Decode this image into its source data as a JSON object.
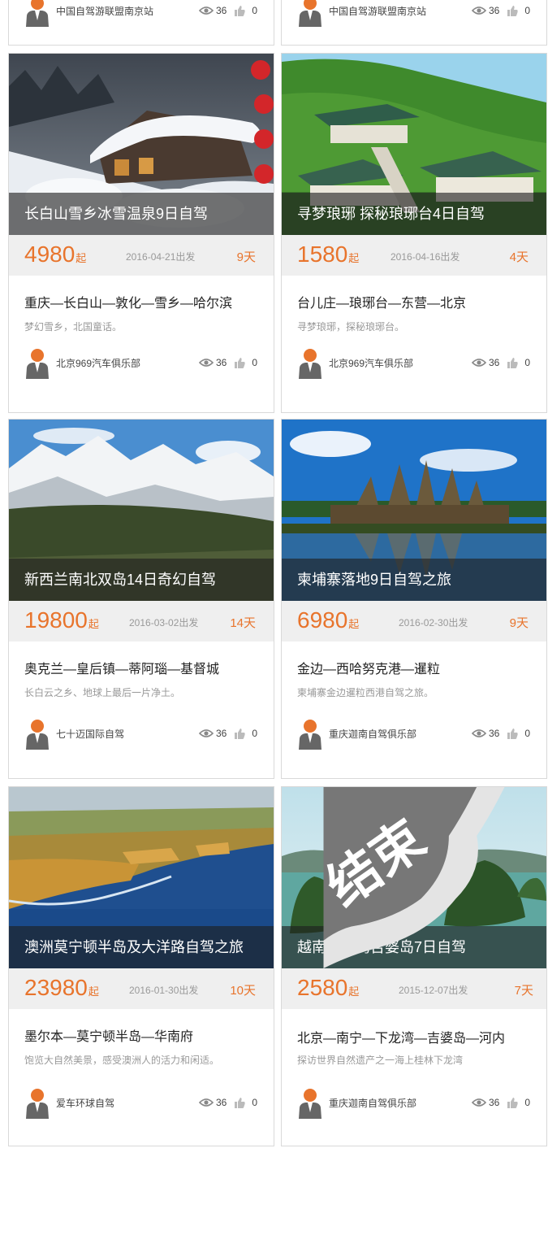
{
  "top_cards": [
    {
      "club": "中国自驾游联盟南京站",
      "views": "36",
      "likes": "0"
    },
    {
      "club": "中国自驾游联盟南京站",
      "views": "36",
      "likes": "0"
    }
  ],
  "cards": [
    {
      "title": "长白山雪乡冰雪温泉9日自驾",
      "price": "4980",
      "price_suffix": "起",
      "date": "2016-04-21出发",
      "days": "9天",
      "route": "重庆—长白山—敦化—雪乡—哈尔滨",
      "desc": "梦幻雪乡，北国童话。",
      "club": "北京969汽车俱乐部",
      "views": "36",
      "likes": "0",
      "ended": false,
      "scene": "snow-village"
    },
    {
      "title": "寻梦琅琊 探秘琅琊台4日自驾",
      "price": "1580",
      "price_suffix": "起",
      "date": "2016-04-16出发",
      "days": "4天",
      "route": "台儿庄—琅琊台—东营—北京",
      "desc": "寻梦琅琊，探秘琅琊台。",
      "club": "北京969汽车俱乐部",
      "views": "36",
      "likes": "0",
      "ended": false,
      "scene": "temple-hill"
    },
    {
      "title": "新西兰南北双岛14日奇幻自驾",
      "price": "19800",
      "price_suffix": "起",
      "date": "2016-03-02出发",
      "days": "14天",
      "route": "奥克兰—皇后镇—蒂阿瑙—基督城",
      "desc": "长白云之乡、地球上最后一片净土。",
      "club": "七十迈国际自驾",
      "views": "36",
      "likes": "0",
      "ended": false,
      "scene": "snow-mountain"
    },
    {
      "title": "柬埔寨落地9日自驾之旅",
      "price": "6980",
      "price_suffix": "起",
      "date": "2016-02-30出发",
      "days": "9天",
      "route": "金边—西哈努克港—暹粒",
      "desc": "柬埔寨金边暹粒西港自驾之旅。",
      "club": "重庆迦南自驾俱乐部",
      "views": "36",
      "likes": "0",
      "ended": false,
      "scene": "angkor"
    },
    {
      "title": "澳洲莫宁顿半岛及大洋路自驾之旅",
      "price": "23980",
      "price_suffix": "起",
      "date": "2016-01-30出发",
      "days": "10天",
      "route": "墨尔本—莫宁顿半岛—华南府",
      "desc": "饱览大自然美景，感受澳洲人的活力和闲适。",
      "club": "爱车环球自驾",
      "views": "36",
      "likes": "0",
      "ended": false,
      "scene": "coast"
    },
    {
      "title": "越南下龙湾吉婆岛7日自驾",
      "price": "2580",
      "price_suffix": "起",
      "date": "2015-12-07出发",
      "days": "7天",
      "route": "北京—南宁—下龙湾—吉婆岛—河内",
      "desc": "探访世界自然遗产之一海上桂林下龙湾",
      "club": "重庆迦南自驾俱乐部",
      "views": "36",
      "likes": "0",
      "ended": true,
      "ended_label": "结束",
      "scene": "halong-bay"
    }
  ],
  "colors": {
    "accent": "#e8742c",
    "price_bar": "#efefef",
    "border": "#d9d9d9"
  },
  "icons": {
    "avatar": "user-avatar-icon",
    "views": "eye-icon",
    "likes": "thumbs-up-icon",
    "ended": "ended-stamp-icon"
  }
}
